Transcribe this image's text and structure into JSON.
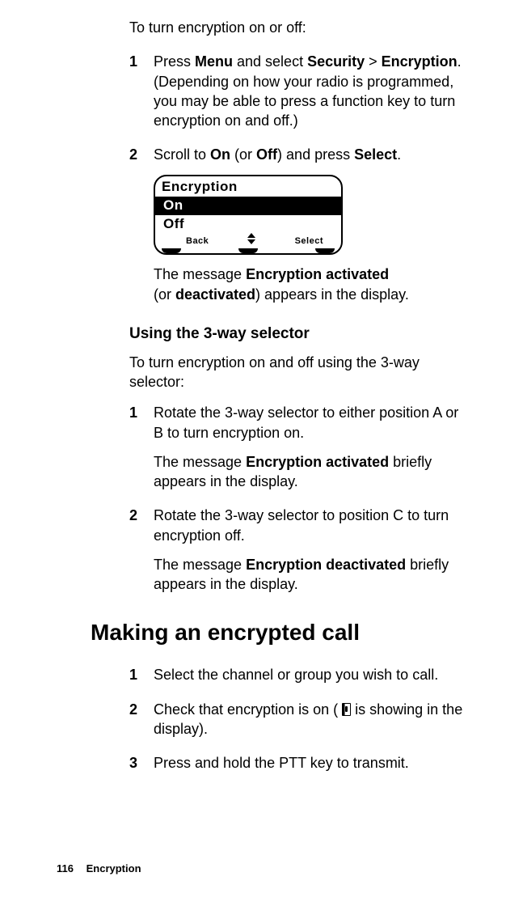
{
  "intro": "To turn encryption on or off:",
  "step1": {
    "num": "1",
    "p1a": "Press ",
    "p1b": "Menu",
    "p1c": " and select ",
    "p1d": "Security",
    "p1e": " > ",
    "p1f": "Encryption",
    "p1g": ". (Depending on how your radio is programmed, you may be able to press a function key to turn encryption on and off.)"
  },
  "step2": {
    "num": "2",
    "p1a": "Scroll to ",
    "p1b": "On",
    "p1c": " (or ",
    "p1d": "Off",
    "p1e": ") and press ",
    "p1f": "Select",
    "p1g": ".",
    "result_a": "The message ",
    "result_b": "Encryption activated",
    "result_c": " (or ",
    "result_d": "deactivated",
    "result_e": ") appears in the display."
  },
  "display": {
    "title": "Encryption",
    "opt_on": "On",
    "opt_off": "Off",
    "back": "Back",
    "select": "Select"
  },
  "selector": {
    "heading": "Using the 3-way selector",
    "intro": "To turn encryption on and off using the 3-way selector:",
    "s1": {
      "num": "1",
      "p1": "Rotate the 3-way selector to either position A or B to turn encryption on.",
      "p2a": "The message ",
      "p2b": "Encryption activated",
      "p2c": " briefly appears in the display."
    },
    "s2": {
      "num": "2",
      "p1": "Rotate the 3-way selector to position C to turn encryption off.",
      "p2a": "The message ",
      "p2b": "Encryption deactivated",
      "p2c": " briefly appears in the display."
    }
  },
  "call": {
    "heading": "Making an encrypted call",
    "s1": {
      "num": "1",
      "p1": "Select the channel or group you wish to call."
    },
    "s2": {
      "num": "2",
      "p1a": "Check that encryption is on ( ",
      "p1b": " is showing in the display)."
    },
    "s3": {
      "num": "3",
      "p1": "Press and hold the PTT key to transmit."
    }
  },
  "footer": {
    "page": "116",
    "title": "Encryption"
  }
}
